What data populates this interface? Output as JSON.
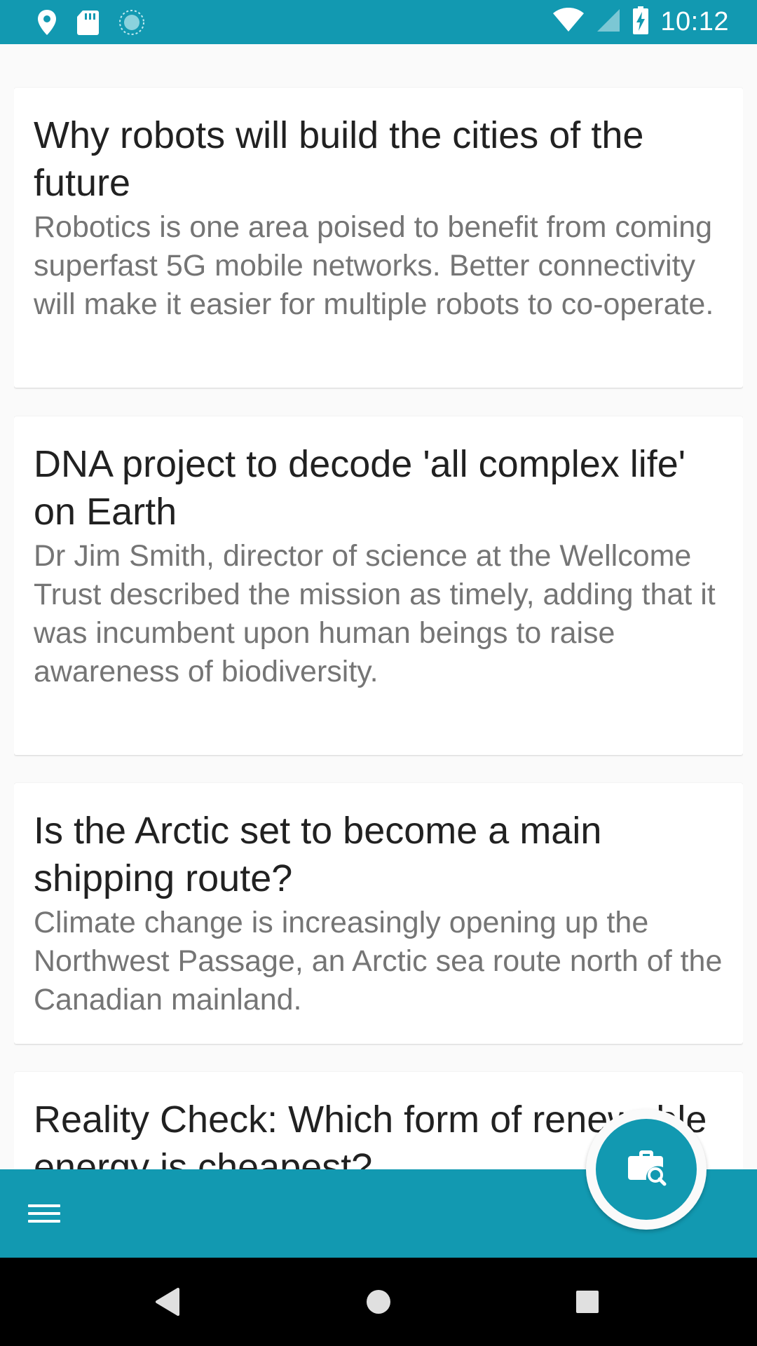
{
  "colors": {
    "primary": "#1299b1",
    "title_text": "#212121",
    "summary_text": "#757575",
    "background": "#fafafa"
  },
  "status_bar": {
    "time": "10:12",
    "left_icons": [
      "location-icon",
      "sd-card-icon",
      "sync-icon"
    ],
    "right_icons": [
      "wifi-icon",
      "cell-signal-icon",
      "battery-charging-icon"
    ]
  },
  "articles": [
    {
      "title": "Why robots will build the cities of the future",
      "summary": "Robotics is one area poised to benefit from coming superfast 5G mobile networks. Better connectivity will make it easier for multiple robots to co-operate."
    },
    {
      "title": "DNA project to decode 'all complex life' on Earth",
      "summary": "Dr Jim Smith, director of science at the Wellcome Trust described the mission as timely, adding that it was incumbent upon human beings to raise awareness of biodiversity."
    },
    {
      "title": "Is the Arctic set to become a main shipping route?",
      "summary": "Climate change is increasingly opening up the Northwest Passage, an Arctic sea route north of the Canadian mainland."
    },
    {
      "title": "Reality Check: Which form of renewable energy is cheapest?",
      "summary": ""
    }
  ],
  "bottom_bar": {
    "menu_icon": "menu-icon",
    "fab_icon": "briefcase-search-icon"
  },
  "nav_bar": {
    "icons": [
      "back-icon",
      "home-icon",
      "recents-icon"
    ]
  }
}
